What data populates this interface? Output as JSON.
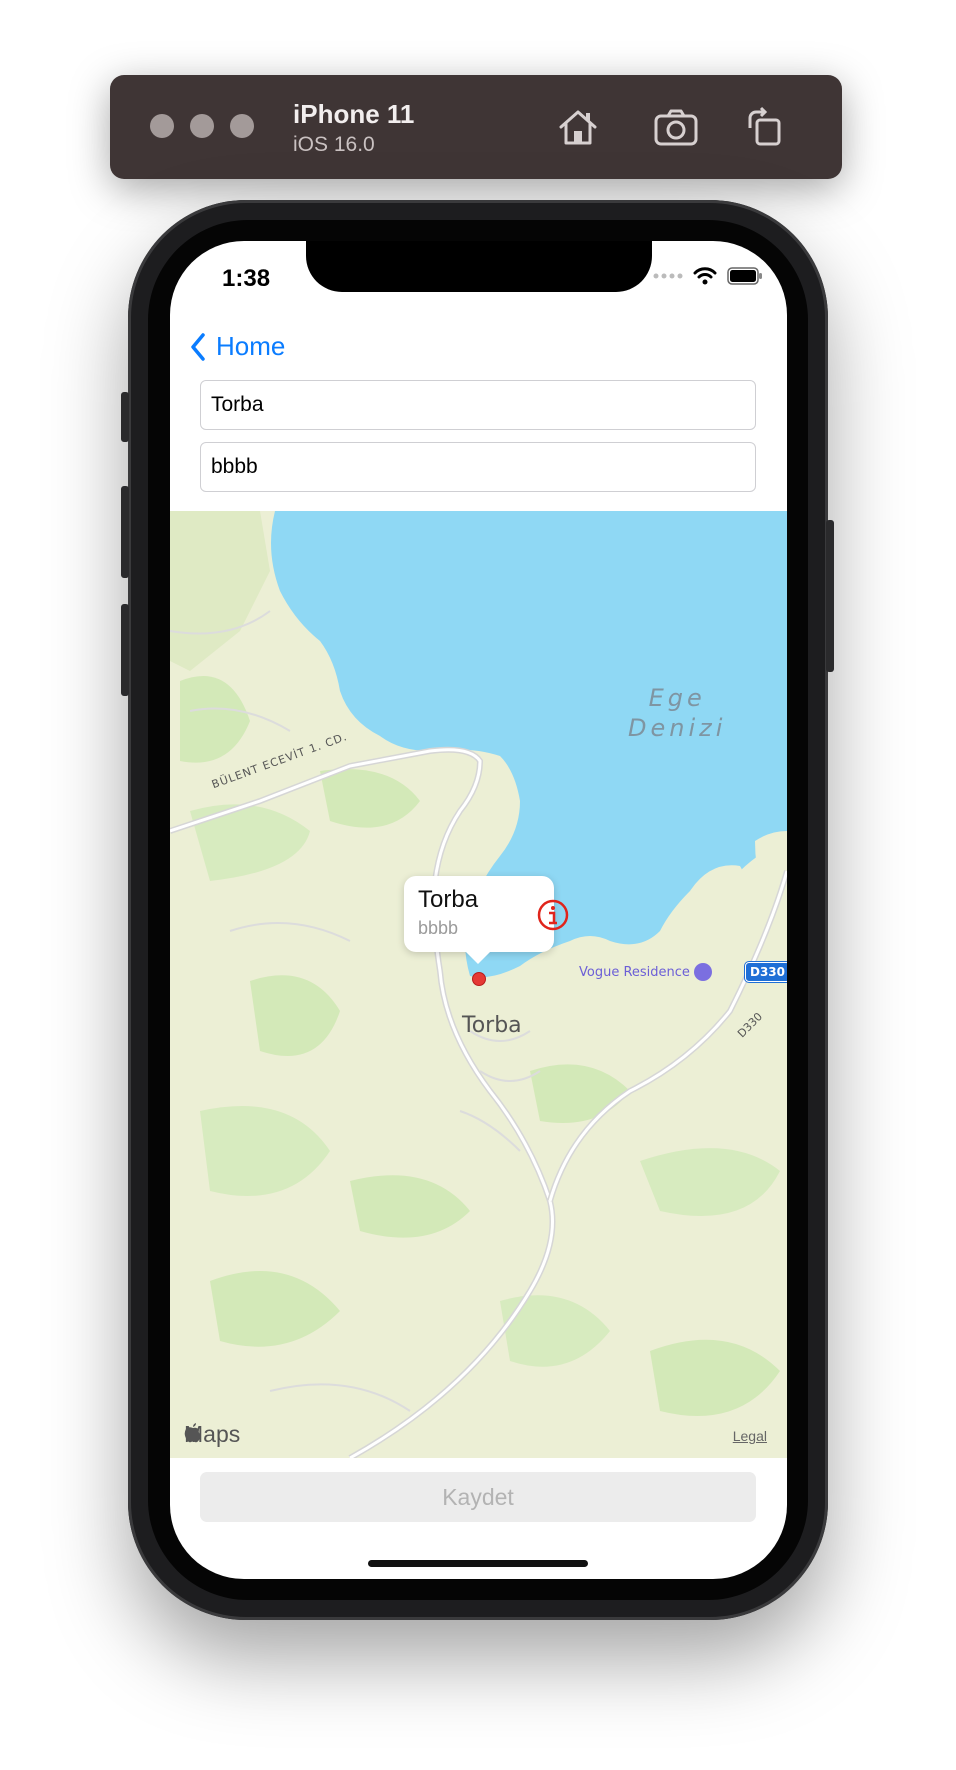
{
  "simulator": {
    "device_name": "iPhone 11",
    "os_version": "iOS 16.0",
    "icons": [
      "home-icon",
      "screenshot-icon",
      "rotate-icon"
    ]
  },
  "status_bar": {
    "time": "1:38"
  },
  "nav": {
    "back_label": "Home"
  },
  "form": {
    "title_field_value": "Torba",
    "subtitle_field_value": "bbbb"
  },
  "map": {
    "sea_label_line1": "Ege",
    "sea_label_line2": "Denizi",
    "road_label": "BÜLENT ECEVİT 1. CD.",
    "town_label": "Torba",
    "poi_label": "Vogue Residence",
    "highway_shield": "D330",
    "highway_label": "D330",
    "maps_brand": "Maps",
    "legal_label": "Legal",
    "annotation": {
      "title": "Torba",
      "subtitle": "bbbb"
    },
    "colors": {
      "sea": "#8fd8f4",
      "land": "#ecefd5",
      "green": "#d3e9b8",
      "pin": "#e53935"
    }
  },
  "actions": {
    "save_label": "Kaydet"
  },
  "colors": {
    "accent": "#0a7cff",
    "info_icon": "#e0251c"
  }
}
